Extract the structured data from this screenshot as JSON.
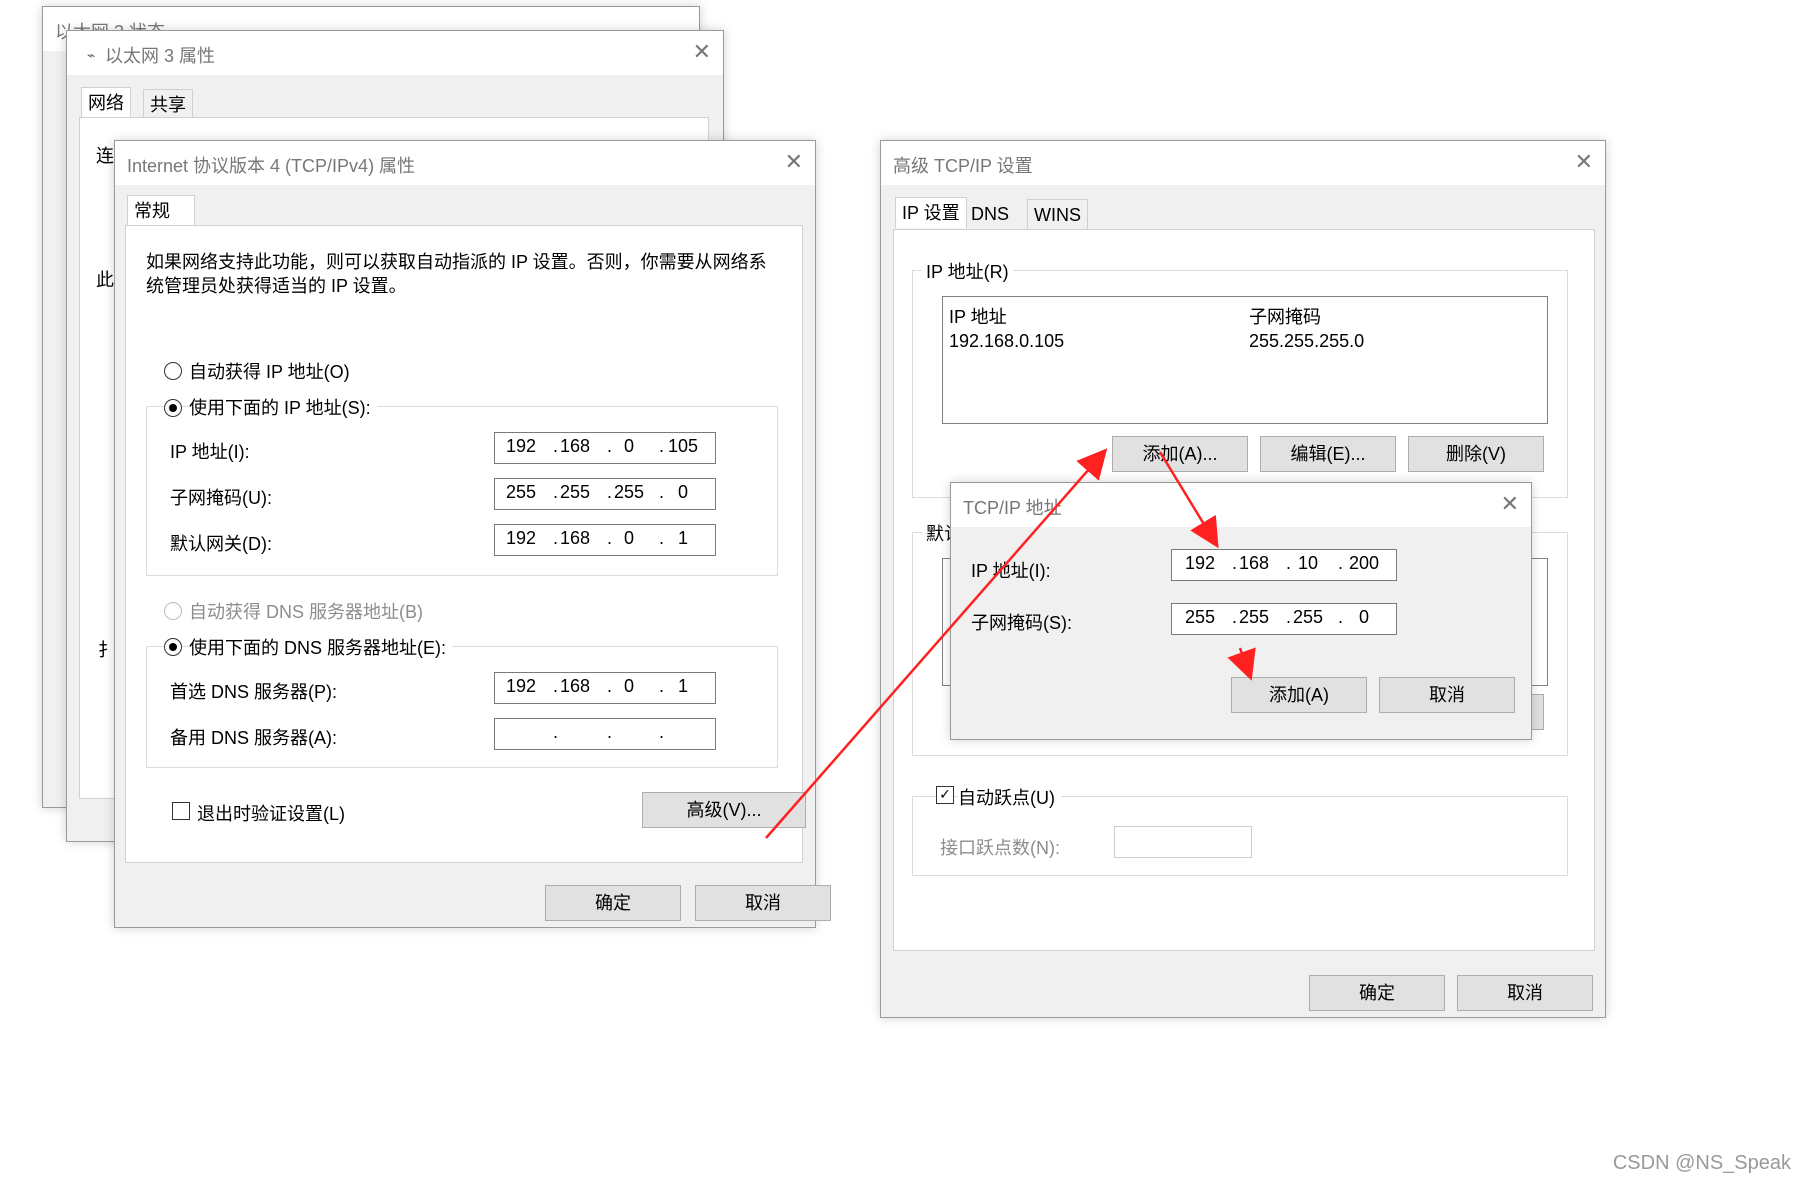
{
  "window_status": {
    "title": "以太网 3 状态"
  },
  "window_props": {
    "title": "以太网 3 属性",
    "tabs": [
      "网络",
      "共享"
    ],
    "partial_labels": [
      "连",
      "此",
      "扌"
    ]
  },
  "window_ipv4": {
    "title": "Internet 协议版本 4 (TCP/IPv4) 属性",
    "tab": "常规",
    "description_line1": "如果网络支持此功能，则可以获取自动指派的 IP 设置。否则，你需要从网络系",
    "description_line2": "统管理员处获得适当的 IP 设置。",
    "radio_auto_ip": "自动获得 IP 地址(O)",
    "radio_manual_ip": "使用下面的 IP 地址(S):",
    "ip_label": "IP 地址(I):",
    "ip_octets": [
      "192",
      "168",
      "0",
      "105"
    ],
    "mask_label": "子网掩码(U):",
    "mask_octets": [
      "255",
      "255",
      "255",
      "0"
    ],
    "gateway_label": "默认网关(D):",
    "gateway_octets": [
      "192",
      "168",
      "0",
      "1"
    ],
    "radio_auto_dns": "自动获得 DNS 服务器地址(B)",
    "radio_manual_dns": "使用下面的 DNS 服务器地址(E):",
    "dns1_label": "首选 DNS 服务器(P):",
    "dns1_octets": [
      "192",
      "168",
      "0",
      "1"
    ],
    "dns2_label": "备用 DNS 服务器(A):",
    "dns2_octets": [
      "",
      "",
      "",
      ""
    ],
    "validate_label": "退出时验证设置(L)",
    "advanced_button": "高级(V)...",
    "ok_button": "确定",
    "cancel_button": "取消"
  },
  "window_advanced": {
    "title": "高级 TCP/IP 设置",
    "tabs": [
      "IP 设置",
      "DNS",
      "WINS"
    ],
    "group_ip": "IP 地址(R)",
    "col_ip": "IP 地址",
    "col_mask": "子网掩码",
    "row_ip": "192.168.0.105",
    "row_mask": "255.255.255.0",
    "add_button": "添加(A)...",
    "edit_button": "编辑(E)...",
    "delete_button": "删除(V)",
    "group_gateway_partial": "默认",
    "auto_metric_label": "自动跃点(U)",
    "metric_label": "接口跃点数(N):",
    "ok_button": "确定",
    "cancel_button": "取消"
  },
  "window_tcpip_addr": {
    "title": "TCP/IP 地址",
    "ip_label": "IP 地址(I):",
    "ip_octets": [
      "192",
      "168",
      "10",
      "200"
    ],
    "mask_label": "子网掩码(S):",
    "mask_octets": [
      "255",
      "255",
      "255",
      "0"
    ],
    "add_button": "添加(A)",
    "cancel_button": "取消"
  },
  "annotation_color": "#ff2020",
  "watermark": "CSDN @NS_Speak"
}
